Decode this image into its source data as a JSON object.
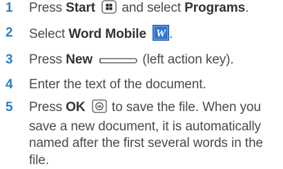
{
  "steps": [
    {
      "number": "1",
      "parts": {
        "a": "Press ",
        "b": "Start",
        "c": " and select ",
        "d": "Programs",
        "e": "."
      },
      "icon": "start-key-icon"
    },
    {
      "number": "2",
      "parts": {
        "a": "Select ",
        "b": "Word Mobile",
        "e": "."
      },
      "icon": "word-mobile-icon"
    },
    {
      "number": "3",
      "parts": {
        "a": "Press ",
        "b": "New",
        "c": " (left action key)."
      },
      "icon": "left-action-key-icon"
    },
    {
      "number": "4",
      "parts": {
        "a": "Enter the text of the document."
      }
    },
    {
      "number": "5",
      "parts": {
        "a": "Press ",
        "b": "OK",
        "c": " to save the file. When you save a new document, it is automatically named after the first several words in the file."
      },
      "icon": "ok-key-icon"
    }
  ],
  "colors": {
    "step_number": "#2e7fbf",
    "text": "#4a4a4a",
    "icon_blue": "#2266cc"
  }
}
